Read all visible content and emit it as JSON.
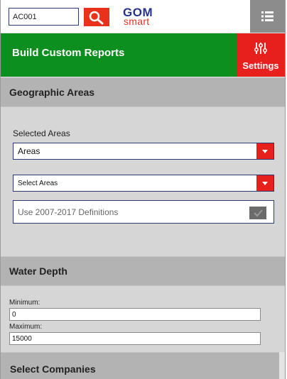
{
  "header": {
    "search_value": "AC001",
    "logo_top": "GOM",
    "logo_bottom": "smart",
    "search_icon": "magnifier-icon",
    "menu_icon": "hamburger-list-icon"
  },
  "titlebar": {
    "title": "Build Custom Reports",
    "settings_label": "Settings",
    "settings_icon": "sliders-icon"
  },
  "geographic": {
    "header": "Geographic Areas",
    "selected_label": "Selected Areas",
    "selected_value": "Areas",
    "select_areas_value": "Select Areas",
    "definitions_label": "Use 2007-2017 Definitions",
    "definitions_checked": true
  },
  "water_depth": {
    "header": "Water Depth",
    "minimum_label": "Minimum:",
    "minimum_value": "0",
    "maximum_label": "Maximum:",
    "maximum_value": "15000"
  },
  "companies": {
    "header": "Select Companies"
  },
  "colors": {
    "accent_red": "#e8201d",
    "title_green": "#0c8f1f",
    "brand_blue": "#25338a"
  }
}
